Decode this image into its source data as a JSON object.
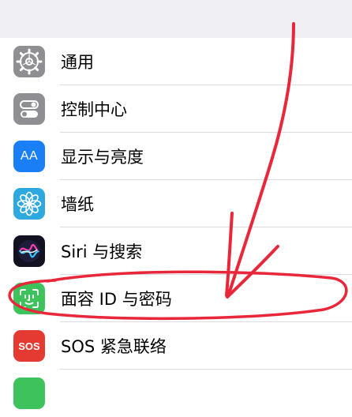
{
  "settings": {
    "items": [
      {
        "label": "通用",
        "icon": "gear-icon",
        "icon_color": "#8e8e93"
      },
      {
        "label": "控制中心",
        "icon": "toggles-icon",
        "icon_color": "#8e8e93"
      },
      {
        "label": "显示与亮度",
        "icon": "text-size-icon",
        "icon_color": "#1a7ff6",
        "glyph": "AA"
      },
      {
        "label": "墙纸",
        "icon": "flower-icon",
        "icon_color": "#2ea9e0"
      },
      {
        "label": "Siri 与搜索",
        "icon": "siri-icon",
        "icon_color": "#111122"
      },
      {
        "label": "面容 ID 与密码",
        "icon": "face-id-icon",
        "icon_color": "#3ec35c"
      },
      {
        "label": "SOS 紧急联络",
        "icon": "sos-icon",
        "icon_color": "#e53a32",
        "glyph": "SOS"
      },
      {
        "label": "",
        "icon": "battery-icon",
        "icon_color": "#3ec35c"
      }
    ]
  },
  "annotation": {
    "color": "#e8283a",
    "arrow": "red-arrow",
    "circle": "red-circle"
  }
}
